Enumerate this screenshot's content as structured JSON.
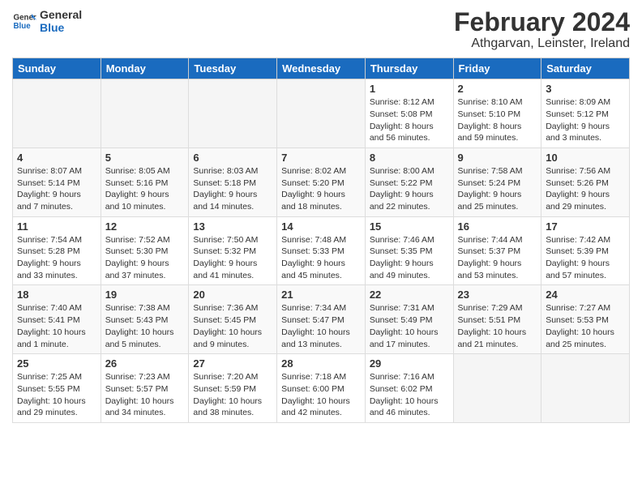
{
  "header": {
    "logo_line1": "General",
    "logo_line2": "Blue",
    "month": "February 2024",
    "location": "Athgarvan, Leinster, Ireland"
  },
  "weekdays": [
    "Sunday",
    "Monday",
    "Tuesday",
    "Wednesday",
    "Thursday",
    "Friday",
    "Saturday"
  ],
  "weeks": [
    [
      {
        "day": "",
        "info": ""
      },
      {
        "day": "",
        "info": ""
      },
      {
        "day": "",
        "info": ""
      },
      {
        "day": "",
        "info": ""
      },
      {
        "day": "1",
        "info": "Sunrise: 8:12 AM\nSunset: 5:08 PM\nDaylight: 8 hours and 56 minutes."
      },
      {
        "day": "2",
        "info": "Sunrise: 8:10 AM\nSunset: 5:10 PM\nDaylight: 8 hours and 59 minutes."
      },
      {
        "day": "3",
        "info": "Sunrise: 8:09 AM\nSunset: 5:12 PM\nDaylight: 9 hours and 3 minutes."
      }
    ],
    [
      {
        "day": "4",
        "info": "Sunrise: 8:07 AM\nSunset: 5:14 PM\nDaylight: 9 hours and 7 minutes."
      },
      {
        "day": "5",
        "info": "Sunrise: 8:05 AM\nSunset: 5:16 PM\nDaylight: 9 hours and 10 minutes."
      },
      {
        "day": "6",
        "info": "Sunrise: 8:03 AM\nSunset: 5:18 PM\nDaylight: 9 hours and 14 minutes."
      },
      {
        "day": "7",
        "info": "Sunrise: 8:02 AM\nSunset: 5:20 PM\nDaylight: 9 hours and 18 minutes."
      },
      {
        "day": "8",
        "info": "Sunrise: 8:00 AM\nSunset: 5:22 PM\nDaylight: 9 hours and 22 minutes."
      },
      {
        "day": "9",
        "info": "Sunrise: 7:58 AM\nSunset: 5:24 PM\nDaylight: 9 hours and 25 minutes."
      },
      {
        "day": "10",
        "info": "Sunrise: 7:56 AM\nSunset: 5:26 PM\nDaylight: 9 hours and 29 minutes."
      }
    ],
    [
      {
        "day": "11",
        "info": "Sunrise: 7:54 AM\nSunset: 5:28 PM\nDaylight: 9 hours and 33 minutes."
      },
      {
        "day": "12",
        "info": "Sunrise: 7:52 AM\nSunset: 5:30 PM\nDaylight: 9 hours and 37 minutes."
      },
      {
        "day": "13",
        "info": "Sunrise: 7:50 AM\nSunset: 5:32 PM\nDaylight: 9 hours and 41 minutes."
      },
      {
        "day": "14",
        "info": "Sunrise: 7:48 AM\nSunset: 5:33 PM\nDaylight: 9 hours and 45 minutes."
      },
      {
        "day": "15",
        "info": "Sunrise: 7:46 AM\nSunset: 5:35 PM\nDaylight: 9 hours and 49 minutes."
      },
      {
        "day": "16",
        "info": "Sunrise: 7:44 AM\nSunset: 5:37 PM\nDaylight: 9 hours and 53 minutes."
      },
      {
        "day": "17",
        "info": "Sunrise: 7:42 AM\nSunset: 5:39 PM\nDaylight: 9 hours and 57 minutes."
      }
    ],
    [
      {
        "day": "18",
        "info": "Sunrise: 7:40 AM\nSunset: 5:41 PM\nDaylight: 10 hours and 1 minute."
      },
      {
        "day": "19",
        "info": "Sunrise: 7:38 AM\nSunset: 5:43 PM\nDaylight: 10 hours and 5 minutes."
      },
      {
        "day": "20",
        "info": "Sunrise: 7:36 AM\nSunset: 5:45 PM\nDaylight: 10 hours and 9 minutes."
      },
      {
        "day": "21",
        "info": "Sunrise: 7:34 AM\nSunset: 5:47 PM\nDaylight: 10 hours and 13 minutes."
      },
      {
        "day": "22",
        "info": "Sunrise: 7:31 AM\nSunset: 5:49 PM\nDaylight: 10 hours and 17 minutes."
      },
      {
        "day": "23",
        "info": "Sunrise: 7:29 AM\nSunset: 5:51 PM\nDaylight: 10 hours and 21 minutes."
      },
      {
        "day": "24",
        "info": "Sunrise: 7:27 AM\nSunset: 5:53 PM\nDaylight: 10 hours and 25 minutes."
      }
    ],
    [
      {
        "day": "25",
        "info": "Sunrise: 7:25 AM\nSunset: 5:55 PM\nDaylight: 10 hours and 29 minutes."
      },
      {
        "day": "26",
        "info": "Sunrise: 7:23 AM\nSunset: 5:57 PM\nDaylight: 10 hours and 34 minutes."
      },
      {
        "day": "27",
        "info": "Sunrise: 7:20 AM\nSunset: 5:59 PM\nDaylight: 10 hours and 38 minutes."
      },
      {
        "day": "28",
        "info": "Sunrise: 7:18 AM\nSunset: 6:00 PM\nDaylight: 10 hours and 42 minutes."
      },
      {
        "day": "29",
        "info": "Sunrise: 7:16 AM\nSunset: 6:02 PM\nDaylight: 10 hours and 46 minutes."
      },
      {
        "day": "",
        "info": ""
      },
      {
        "day": "",
        "info": ""
      }
    ]
  ]
}
